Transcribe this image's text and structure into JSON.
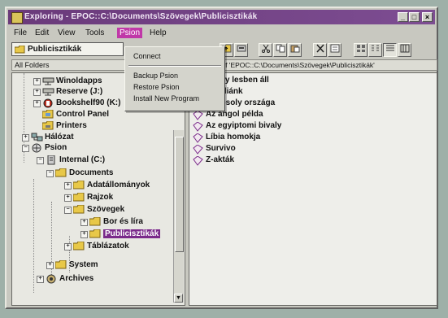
{
  "window": {
    "title": "Exploring - EPOC::C:\\Documents\\Szövegek\\Publicisztikák",
    "buttons": [
      "_",
      "□",
      "×"
    ]
  },
  "menubar": [
    "File",
    "Edit",
    "View",
    "Tools",
    "Psion",
    "Help"
  ],
  "psion_menu": [
    "Connect",
    "Backup Psion",
    "Restore Psion",
    "Install New Program"
  ],
  "address_box": "Publicisztikák",
  "left_header": "All Folders",
  "right_header": "Contents of 'EPOC::C:\\Documents\\Szövegek\\Publicisztikák'",
  "tree": [
    {
      "label": "Winoldapps",
      "icon": "network-drive-icon",
      "expander": "+"
    },
    {
      "label": "Reserve (J:)",
      "icon": "network-drive-icon",
      "expander": "+"
    },
    {
      "label": "Bookshelf90 (K:)",
      "icon": "bookshelf-icon",
      "expander": "+"
    },
    {
      "label": "Control Panel",
      "icon": "control-panel-icon",
      "expander": ""
    },
    {
      "label": "Printers",
      "icon": "printers-folder-icon",
      "expander": ""
    },
    {
      "label": "Hálózat",
      "icon": "network-icon",
      "expander": "+"
    },
    {
      "label": "Psion",
      "icon": "psion-icon",
      "expander": "−"
    },
    {
      "label": "Internal (C:)",
      "icon": "internal-drive-icon",
      "expander": "−"
    },
    {
      "label": "Documents",
      "icon": "folder-open-icon",
      "expander": "−"
    },
    {
      "label": "Adatállományok",
      "icon": "folder-icon",
      "expander": "+"
    },
    {
      "label": "Rajzok",
      "icon": "folder-icon",
      "expander": "+"
    },
    {
      "label": "Szövegek",
      "icon": "folder-open-icon",
      "expander": "−"
    },
    {
      "label": "Bor és líra",
      "icon": "folder-icon",
      "expander": "+"
    },
    {
      "label": "Publicisztikák",
      "icon": "folder-open-icon",
      "expander": "+"
    },
    {
      "label": "Táblázatok",
      "icon": "folder-icon",
      "expander": "+"
    },
    {
      "label": "System",
      "icon": "folder-icon",
      "expander": "+"
    },
    {
      "label": "Archives",
      "icon": "archives-icon",
      "expander": "+"
    }
  ],
  "files": [
    "Bivaly lesben áll",
    "Szicíliánk",
    "A mosoly országa",
    "Az angol példa",
    "Az egyiptomi bivaly",
    "Líbia homokja",
    "Survivo",
    "Z-akták"
  ],
  "colors": {
    "titlebar": "#6a3a7a",
    "menu_highlight": "#c038a8",
    "selection": "#7a2a8a",
    "folder": "#e8c848"
  }
}
